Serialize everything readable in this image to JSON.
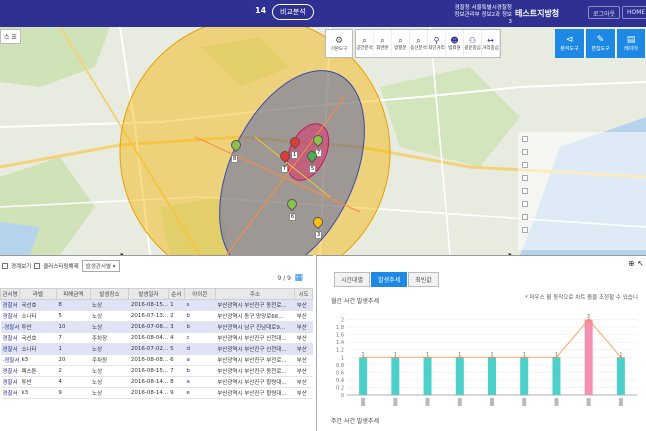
{
  "topbar": {
    "count": "14",
    "pill_label": "비교분석",
    "org_line1": "경찰청 서울특별시경찰청",
    "org_line2": "정보관리부 정보2과 정보3",
    "brand": "테스트지방청",
    "logout_label": "로그아웃",
    "home_label": "HOME"
  },
  "map": {
    "left_label": "스 ☰",
    "basemap_label": "기본도구",
    "tools": [
      {
        "icon": "관",
        "label": "공간분석"
      },
      {
        "icon": "반",
        "label": "최반반"
      },
      {
        "icon": "방",
        "label": "방향분"
      },
      {
        "icon": "동",
        "label": "동선분석"
      },
      {
        "icon": "최",
        "label": "최단거리"
      },
      {
        "icon": "범",
        "label": "범죄원"
      },
      {
        "icon": "광",
        "label": "광운중심"
      },
      {
        "icon": "거",
        "label": "거리중심"
      }
    ],
    "blue_tools": [
      {
        "icon": "⊲",
        "label": "분석도구"
      },
      {
        "icon": "✎",
        "label": "편집도구"
      },
      {
        "icon": "▤",
        "label": "레이어"
      }
    ],
    "right_panel_rows": [
      "",
      "",
      "",
      "",
      "",
      "",
      "",
      ""
    ],
    "pins": [
      {
        "label": "8",
        "color": "#8bc34a"
      },
      {
        "label": "1",
        "color": "#e53935"
      },
      {
        "label": "7",
        "color": "#8bc34a"
      },
      {
        "label": "5",
        "color": "#4caf50"
      },
      {
        "label": "3",
        "color": "#ffc107"
      },
      {
        "label": "6",
        "color": "#8bc34a"
      },
      {
        "label": "T",
        "color": "#e53935"
      }
    ]
  },
  "left_panel": {
    "label_view": "경계보기",
    "cluster_label": "클러스터링해제",
    "select_value": "발생관서별",
    "pager": "9 / 9",
    "columns": [
      "관서명",
      "라벨",
      "피해금액",
      "발생장소",
      "발생일자",
      "순서",
      "아이콘",
      "주소",
      "시도"
    ],
    "rows": [
      {
        "c": [
          "경찰서",
          "국선호",
          "8",
          "노상",
          "2016-08-15...",
          "1",
          "s",
          "부산광역시 부산진구 동천로...",
          "부산"
        ],
        "hl": true
      },
      {
        "c": [
          "경찰서",
          "소나타",
          "5",
          "노상",
          "2016-07-13...",
          "2",
          "b",
          "부산광역시 동구 망양로66...",
          "부산"
        ],
        "hl": false
      },
      {
        "c": [
          "·경찰서",
          "투싼",
          "10",
          "노상",
          "2016-07-08...",
          "3",
          "b",
          "부산광역시 남구 진남대로9...",
          "부산"
        ],
        "hl": true
      },
      {
        "c": [
          "경찰서",
          "국선호",
          "7",
          "주차장",
          "2016-08-04...",
          "4",
          "c",
          "부산광역시 부산진구 신천대...",
          "부산"
        ],
        "hl": false
      },
      {
        "c": [
          "경찰서",
          "소나타",
          "1",
          "노상",
          "2016-07-02...",
          "5",
          "d",
          "부산광역시 부산진구 신천대...",
          "부산"
        ],
        "hl": true
      },
      {
        "c": [
          "·경찰서",
          "k3",
          "20",
          "주차장",
          "2016-08-08...",
          "6",
          "a",
          "부산광역시 부산진구 부전로...",
          "부산"
        ],
        "hl": false
      },
      {
        "c": [
          "경찰서",
          "렉스톤",
          "2",
          "노상",
          "2016-08-15...",
          "7",
          "b",
          "부산광역시 부산진구 동천로...",
          "부산"
        ],
        "hl": false
      },
      {
        "c": [
          "경찰서",
          "투싼",
          "4",
          "노상",
          "2016-08-14...",
          "8",
          "a",
          "부산광역시 부산진구 황령대...",
          "부산"
        ],
        "hl": false
      },
      {
        "c": [
          "경찰서",
          "k3",
          "9",
          "노상",
          "2016-08-14...",
          "9",
          "e",
          "부산광역시 부산진구 황령대...",
          "부산"
        ],
        "hl": false
      }
    ]
  },
  "right_panel": {
    "tabs": [
      "시간대별",
      "발생추세",
      "최빈값"
    ],
    "active_tab": 1,
    "section1_title": "월간 사건 발생추세",
    "hint": "* 마우스 휠 동작으로 차트 줌을 조정할 수 있습니",
    "section2_title": "주간 사건 발생추세",
    "zoom_icons": "⊕ ↖"
  },
  "chart_data": {
    "type": "bar",
    "title": "월간 사건 발생추세",
    "categories": [
      "",
      "",
      "",
      "",
      "",
      "",
      "",
      "",
      ""
    ],
    "values": [
      1,
      1,
      1,
      1,
      1,
      1,
      1,
      2,
      1
    ],
    "ylim": [
      0,
      2.2
    ],
    "y_ticks": [
      "2",
      "1.8",
      "1.6",
      "1.4",
      "1.2",
      "1",
      "0.8",
      "0.6",
      "0.4",
      "0.2",
      "0"
    ],
    "bar_color": "#4dd0c9",
    "highlight_index": 7,
    "highlight_color": "#f48fb1",
    "line_color": "#ff8f3f"
  }
}
